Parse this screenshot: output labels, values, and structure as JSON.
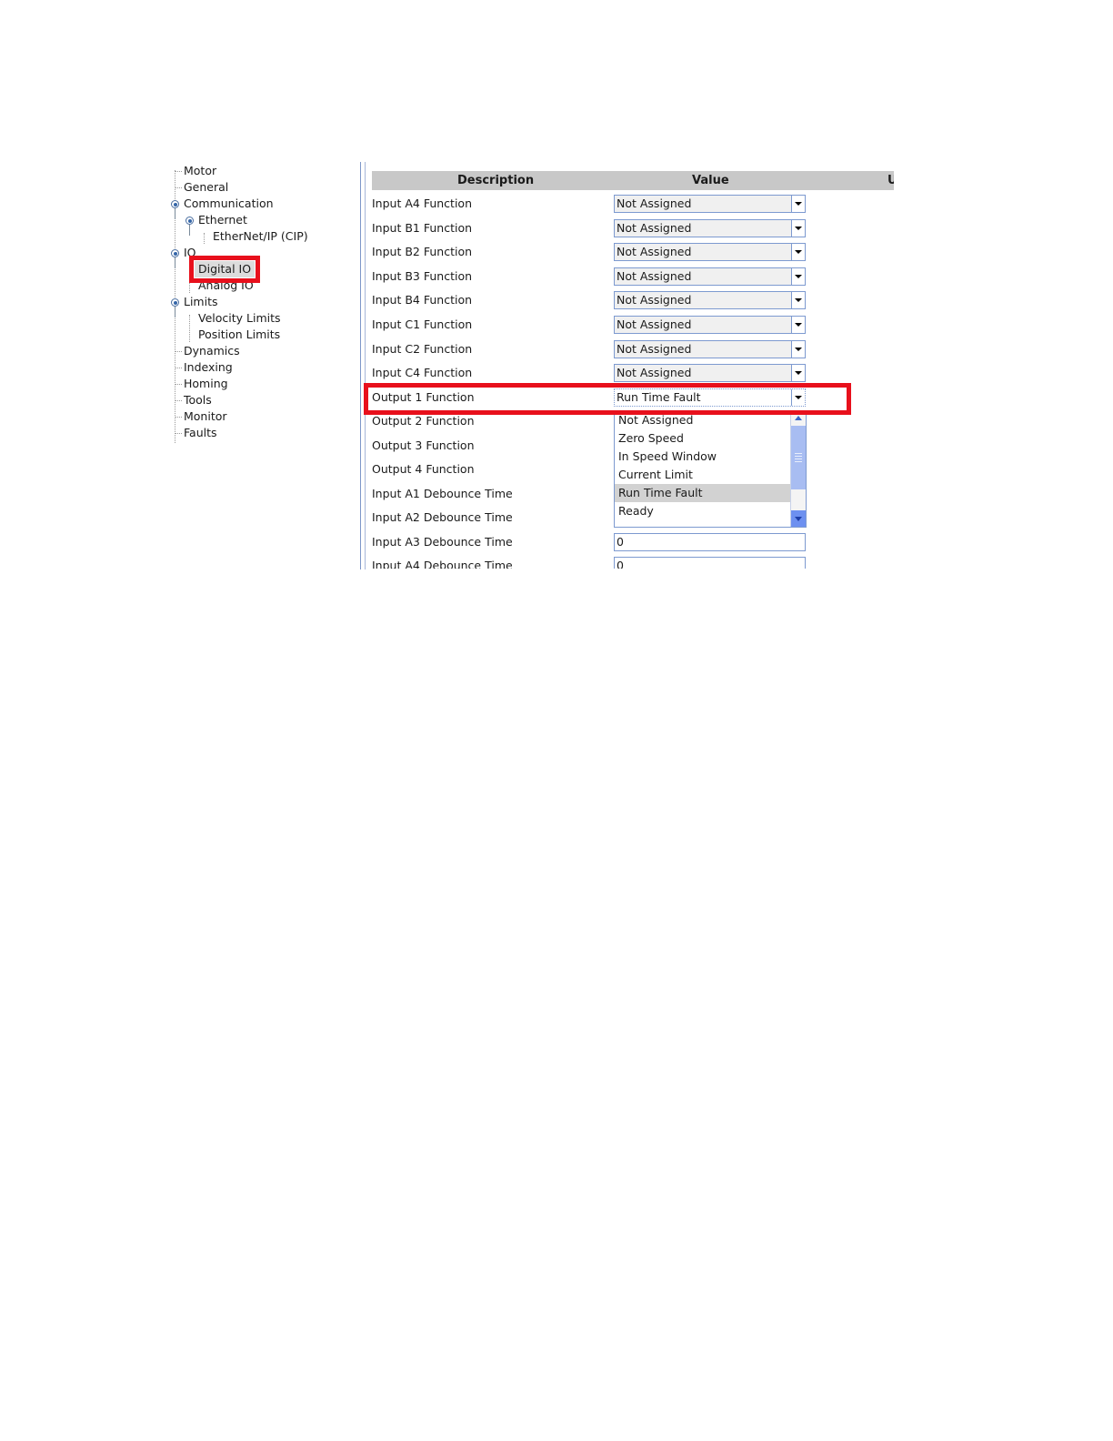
{
  "tree": {
    "items": [
      {
        "label": "Motor"
      },
      {
        "label": "General"
      },
      {
        "label": "Communication"
      },
      {
        "label": "Ethernet"
      },
      {
        "label": "EtherNet/IP (CIP)"
      },
      {
        "label": "IO"
      },
      {
        "label": "Digital IO"
      },
      {
        "label": "Analog IO"
      },
      {
        "label": "Limits"
      },
      {
        "label": "Velocity Limits"
      },
      {
        "label": "Position Limits"
      },
      {
        "label": "Dynamics"
      },
      {
        "label": "Indexing"
      },
      {
        "label": "Homing"
      },
      {
        "label": "Tools"
      },
      {
        "label": "Monitor"
      },
      {
        "label": "Faults"
      }
    ],
    "selected": "Digital IO"
  },
  "grid": {
    "headers": {
      "description": "Description",
      "value": "Value",
      "units": "U"
    },
    "rows": [
      {
        "description": "Input A4 Function",
        "value": "Not Assigned"
      },
      {
        "description": "Input B1 Function",
        "value": "Not Assigned"
      },
      {
        "description": "Input B2 Function",
        "value": "Not Assigned"
      },
      {
        "description": "Input B3 Function",
        "value": "Not Assigned"
      },
      {
        "description": "Input B4 Function",
        "value": "Not Assigned"
      },
      {
        "description": "Input C1 Function",
        "value": "Not Assigned"
      },
      {
        "description": "Input C2 Function",
        "value": "Not Assigned"
      },
      {
        "description": "Input C4 Function",
        "value": "Not Assigned"
      },
      {
        "description": "Output 1 Function",
        "value": "Run Time Fault"
      },
      {
        "description": "Output 2 Function",
        "value": ""
      },
      {
        "description": "Output 3 Function",
        "value": ""
      },
      {
        "description": "Output 4 Function",
        "value": ""
      },
      {
        "description": "Input A1 Debounce Time",
        "value": ""
      },
      {
        "description": "Input A2 Debounce Time",
        "value": ""
      },
      {
        "description": "Input A3 Debounce Time",
        "value": "0"
      },
      {
        "description": "Input A4 Debounce Time",
        "value": "0"
      }
    ],
    "dropdown": {
      "options": [
        "Not Assigned",
        "Zero Speed",
        "In Speed Window",
        "Current Limit",
        "Run Time Fault",
        "Ready"
      ],
      "selected": "Run Time Fault"
    }
  },
  "colors": {
    "highlight": "#e8101c",
    "header_bg": "#c8c8c8",
    "combo_border": "#7d9ad0"
  }
}
